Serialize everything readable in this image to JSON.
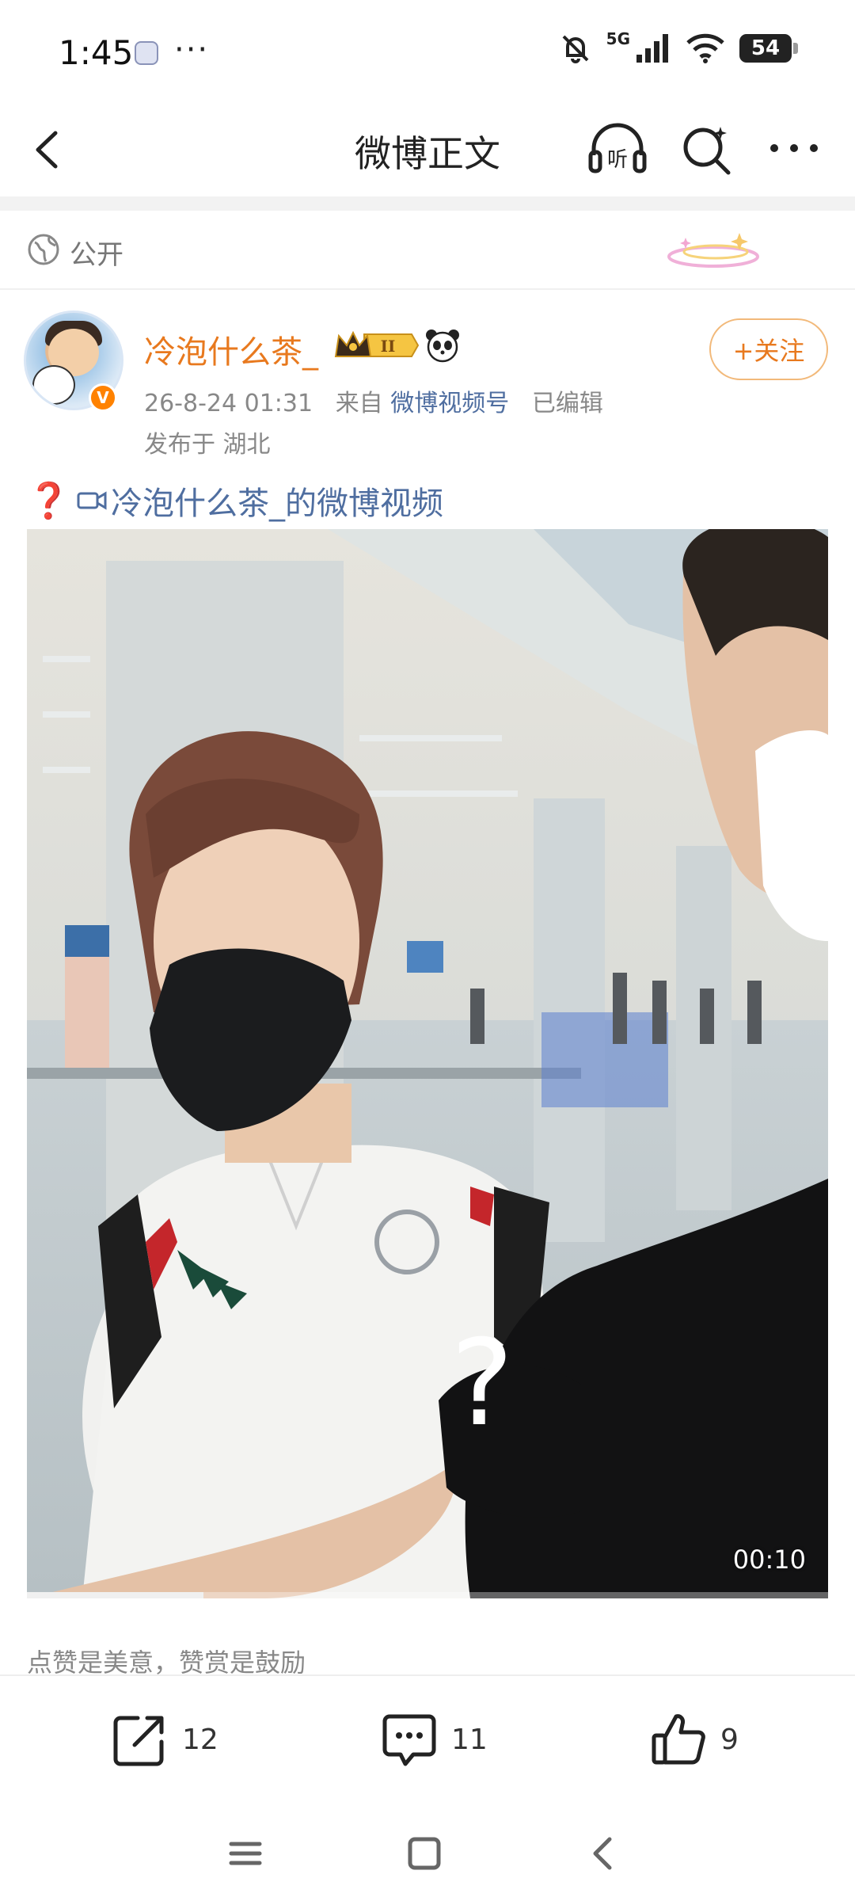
{
  "status_bar": {
    "time": "1:45",
    "more": "···",
    "network": "5G",
    "battery": "54"
  },
  "header": {
    "title": "微博正文",
    "icons": [
      "back-icon",
      "listen-icon",
      "search-icon",
      "more-icon"
    ]
  },
  "visibility": {
    "label": "公开"
  },
  "post": {
    "username": "冷泡什么茶_",
    "level_badge": "II",
    "follow_label": "+关注",
    "timestamp": "26-8-24 01:31",
    "source_prefix": "来自",
    "source": "微博视频号",
    "edited": "已编辑",
    "location": "发布于 湖北",
    "text_emoji": "❓",
    "video_link": "冷泡什么茶_的微博视频"
  },
  "video": {
    "overlay_glyph": "?",
    "duration": "00:10",
    "progress": 0.22
  },
  "tip": "点赞是美意，赞赏是鼓励",
  "actions": {
    "repost_count": "12",
    "comment_count": "11",
    "like_count": "9"
  },
  "colors": {
    "accent_orange": "#e8791e",
    "link_blue": "#4f6ea0"
  }
}
